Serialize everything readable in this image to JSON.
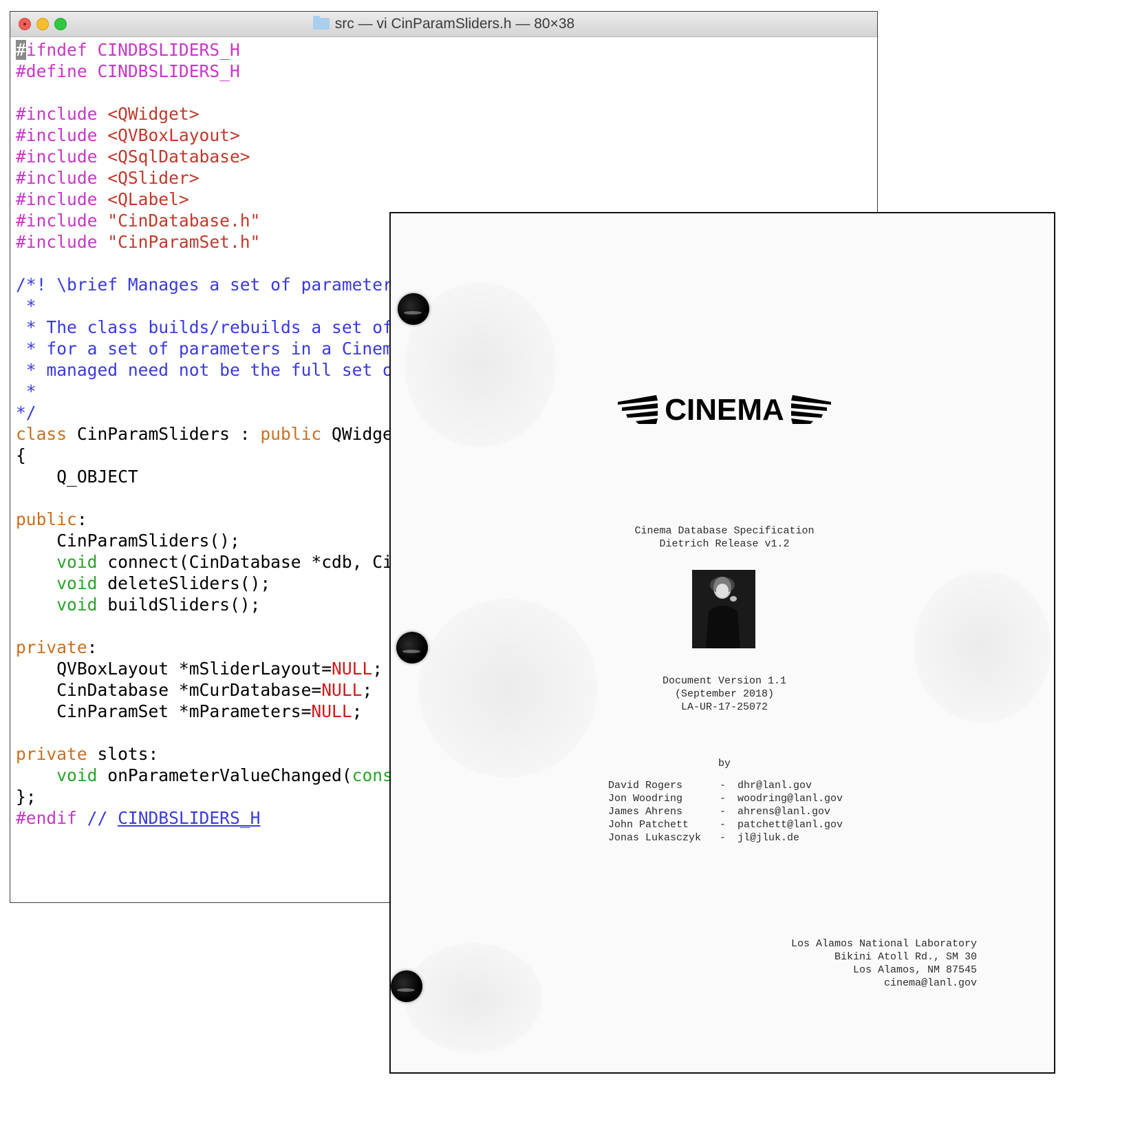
{
  "terminal": {
    "title": "src — vi CinParamSliders.h — 80×38",
    "lines": [
      [
        {
          "t": "#",
          "c": "cursor"
        },
        {
          "t": "ifndef CINDBSLIDERS_H",
          "c": "pp"
        }
      ],
      [
        {
          "t": "#define CINDBSLIDERS_H",
          "c": "pp"
        }
      ],
      [],
      [
        {
          "t": "#include ",
          "c": "pp"
        },
        {
          "t": "<QWidget>",
          "c": "str"
        }
      ],
      [
        {
          "t": "#include ",
          "c": "pp"
        },
        {
          "t": "<QVBoxLayout>",
          "c": "str"
        }
      ],
      [
        {
          "t": "#include ",
          "c": "pp"
        },
        {
          "t": "<QSqlDatabase>",
          "c": "str"
        }
      ],
      [
        {
          "t": "#include ",
          "c": "pp"
        },
        {
          "t": "<QSlider>",
          "c": "str"
        }
      ],
      [
        {
          "t": "#include ",
          "c": "pp"
        },
        {
          "t": "<QLabel>",
          "c": "str"
        }
      ],
      [
        {
          "t": "#include ",
          "c": "pp"
        },
        {
          "t": "\"CinDatabase.h\"",
          "c": "str"
        }
      ],
      [
        {
          "t": "#include ",
          "c": "pp"
        },
        {
          "t": "\"CinParamSet.h\"",
          "c": "str"
        }
      ],
      [],
      [
        {
          "t": "/*! \\brief Manages a set of parameter",
          "c": "cm"
        }
      ],
      [
        {
          "t": " *",
          "c": "cm"
        }
      ],
      [
        {
          "t": " * The class builds/rebuilds a set of",
          "c": "cm"
        }
      ],
      [
        {
          "t": " * for a set of parameters in a Cinema",
          "c": "cm"
        }
      ],
      [
        {
          "t": " * managed need not be the full set of",
          "c": "cm"
        }
      ],
      [
        {
          "t": " *",
          "c": "cm"
        }
      ],
      [
        {
          "t": "*/",
          "c": "cm"
        }
      ],
      [
        {
          "t": "class",
          "c": "kw"
        },
        {
          "t": " CinParamSliders : "
        },
        {
          "t": "public",
          "c": "kw"
        },
        {
          "t": " QWidget"
        }
      ],
      [
        {
          "t": "{"
        }
      ],
      [
        {
          "t": "    Q_OBJECT"
        }
      ],
      [],
      [
        {
          "t": "public",
          "c": "kw"
        },
        {
          "t": ":"
        }
      ],
      [
        {
          "t": "    CinParamSliders();"
        }
      ],
      [
        {
          "t": "    "
        },
        {
          "t": "void",
          "c": "ty"
        },
        {
          "t": " connect(CinDatabase *cdb, CinParamSet"
        }
      ],
      [
        {
          "t": "    "
        },
        {
          "t": "void",
          "c": "ty"
        },
        {
          "t": " deleteSliders();"
        }
      ],
      [
        {
          "t": "    "
        },
        {
          "t": "void",
          "c": "ty"
        },
        {
          "t": " buildSliders();"
        }
      ],
      [],
      [
        {
          "t": "private",
          "c": "kw"
        },
        {
          "t": ":"
        }
      ],
      [
        {
          "t": "    QVBoxLayout *mSliderLayout="
        },
        {
          "t": "NULL",
          "c": "nul"
        },
        {
          "t": ";"
        }
      ],
      [
        {
          "t": "    CinDatabase *mCurDatabase="
        },
        {
          "t": "NULL",
          "c": "nul"
        },
        {
          "t": ";"
        }
      ],
      [
        {
          "t": "    CinParamSet *mParameters="
        },
        {
          "t": "NULL",
          "c": "nul"
        },
        {
          "t": ";"
        }
      ],
      [],
      [
        {
          "t": "private",
          "c": "kw"
        },
        {
          "t": " slots:"
        }
      ],
      [
        {
          "t": "    "
        },
        {
          "t": "void",
          "c": "ty"
        },
        {
          "t": " onParameterValueChanged("
        },
        {
          "t": "const",
          "c": "ty"
        }
      ],
      [
        {
          "t": "};"
        }
      ],
      [
        {
          "t": "#endif",
          "c": "pp"
        },
        {
          "t": " // ",
          "c": "cm"
        },
        {
          "t": "CINDBSLIDERS_H",
          "c": "ul"
        }
      ]
    ]
  },
  "document": {
    "logo_text": "CINEMA",
    "spec_lines": [
      "Cinema Database Specification",
      "Dietrich Release v1.2"
    ],
    "version_lines": [
      "Document Version 1.1",
      "(September 2018)",
      "LA-UR-17-25072"
    ],
    "by": "by",
    "authors": [
      {
        "name": "David Rogers",
        "dash": "-",
        "email": "dhr@lanl.gov"
      },
      {
        "name": "Jon Woodring",
        "dash": "-",
        "email": "woodring@lanl.gov"
      },
      {
        "name": "James Ahrens",
        "dash": "-",
        "email": "ahrens@lanl.gov"
      },
      {
        "name": "John Patchett",
        "dash": "-",
        "email": "patchett@lanl.gov"
      },
      {
        "name": "Jonas Lukasczyk",
        "dash": "-",
        "email": "jl@jluk.de"
      }
    ],
    "address": [
      "Los Alamos National Laboratory",
      "Bikini Atoll Rd., SM 30",
      "Los Alamos, NM 87545",
      "cinema@lanl.gov"
    ]
  }
}
